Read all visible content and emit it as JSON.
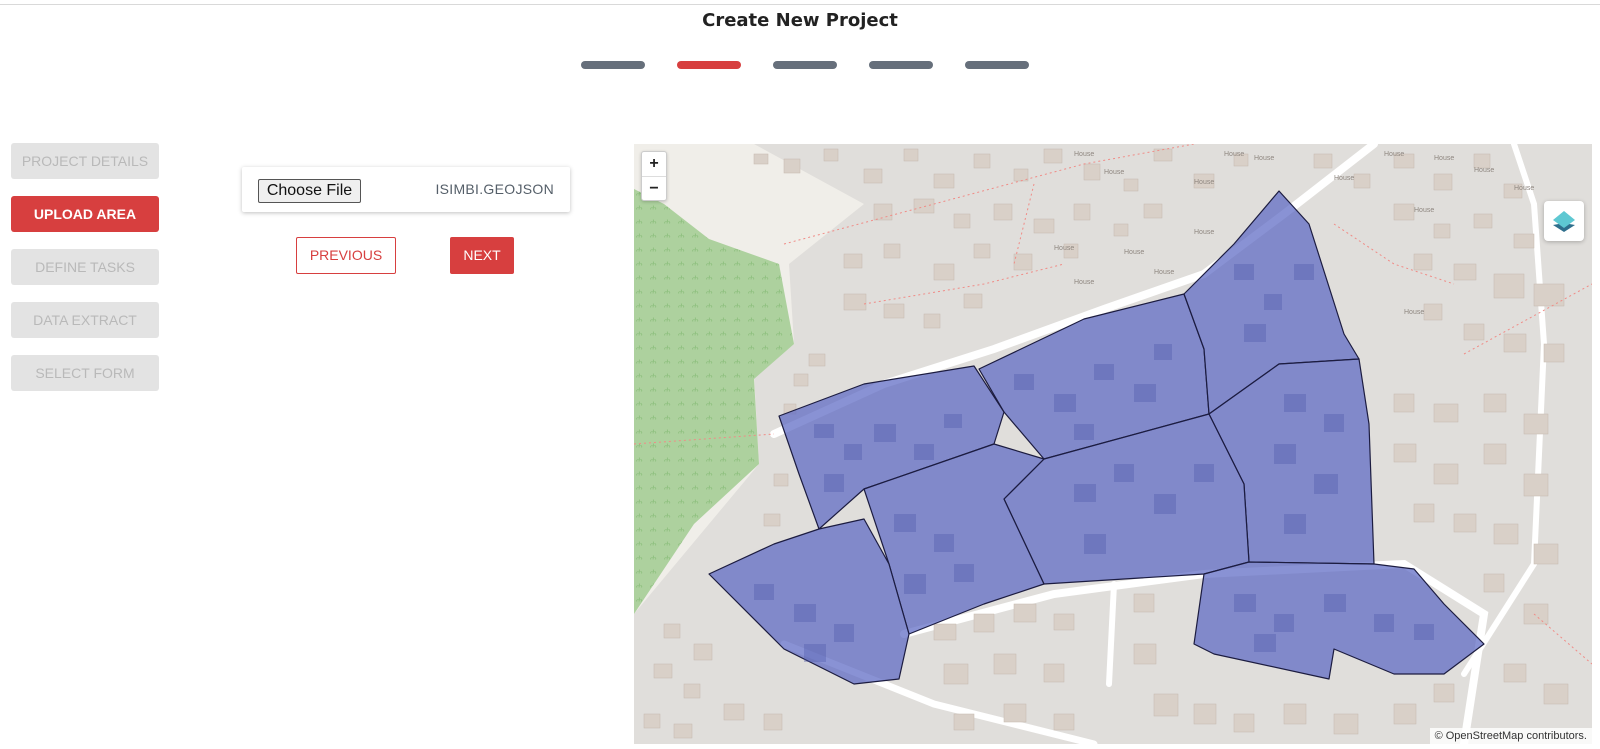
{
  "page": {
    "title": "Create New Project"
  },
  "steps": {
    "count": 5,
    "active_index": 1
  },
  "sidebar": {
    "items": [
      {
        "label": "PROJECT DETAILS",
        "active": false
      },
      {
        "label": "UPLOAD AREA",
        "active": true
      },
      {
        "label": "DEFINE TASKS",
        "active": false
      },
      {
        "label": "DATA EXTRACT",
        "active": false
      },
      {
        "label": "SELECT FORM",
        "active": false
      }
    ]
  },
  "upload": {
    "choose_file_label": "Choose File",
    "file_name": "ISIMBI.GEOJSON"
  },
  "nav": {
    "previous_label": "PREVIOUS",
    "next_label": "NEXT"
  },
  "map": {
    "zoom_in_label": "+",
    "zoom_out_label": "−",
    "attribution": "© OpenStreetMap contributors.",
    "layers_icon": "layers-icon",
    "building_label": "House"
  },
  "colors": {
    "accent": "#d73f3f",
    "step_inactive": "#666f7b",
    "task_fill": "#5b68c4"
  }
}
